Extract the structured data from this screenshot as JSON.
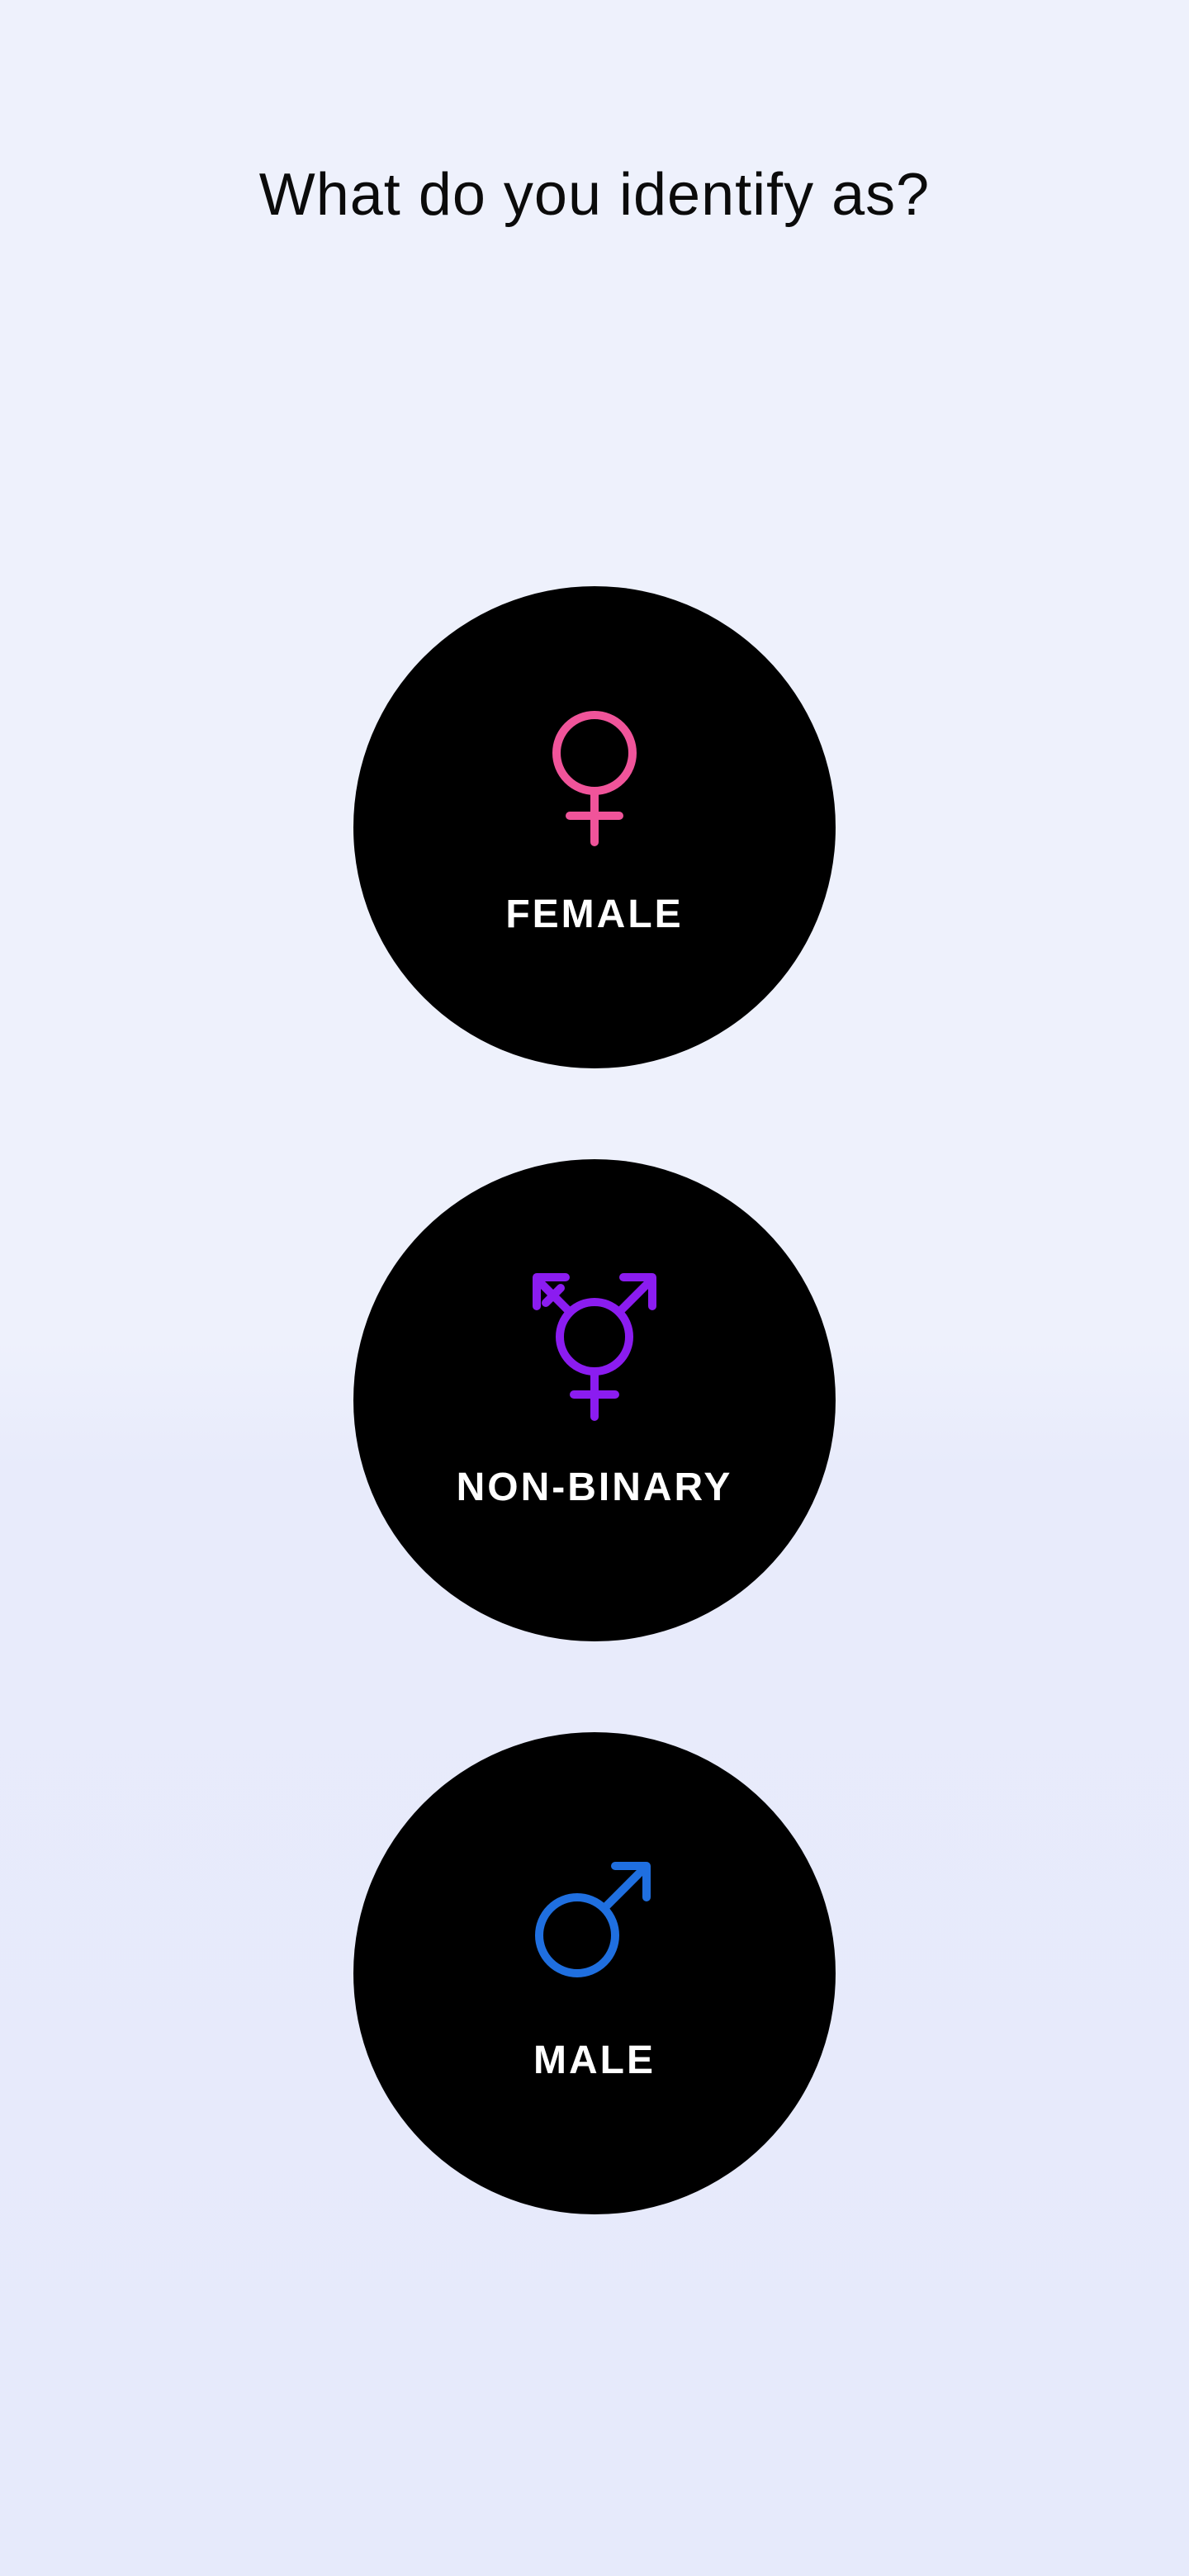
{
  "header": {
    "title": "What do you identify as?"
  },
  "options": [
    {
      "label": "FEMALE",
      "icon": "female-symbol-icon",
      "color": "#f0549a"
    },
    {
      "label": "NON-BINARY",
      "icon": "transgender-symbol-icon",
      "color": "#8b1cf0"
    },
    {
      "label": "MALE",
      "icon": "male-symbol-icon",
      "color": "#1f6fe0"
    }
  ],
  "colors": {
    "background": "#eef1fc",
    "button": "#000000",
    "button_text": "#ffffff",
    "title_text": "#0b0b0b"
  }
}
